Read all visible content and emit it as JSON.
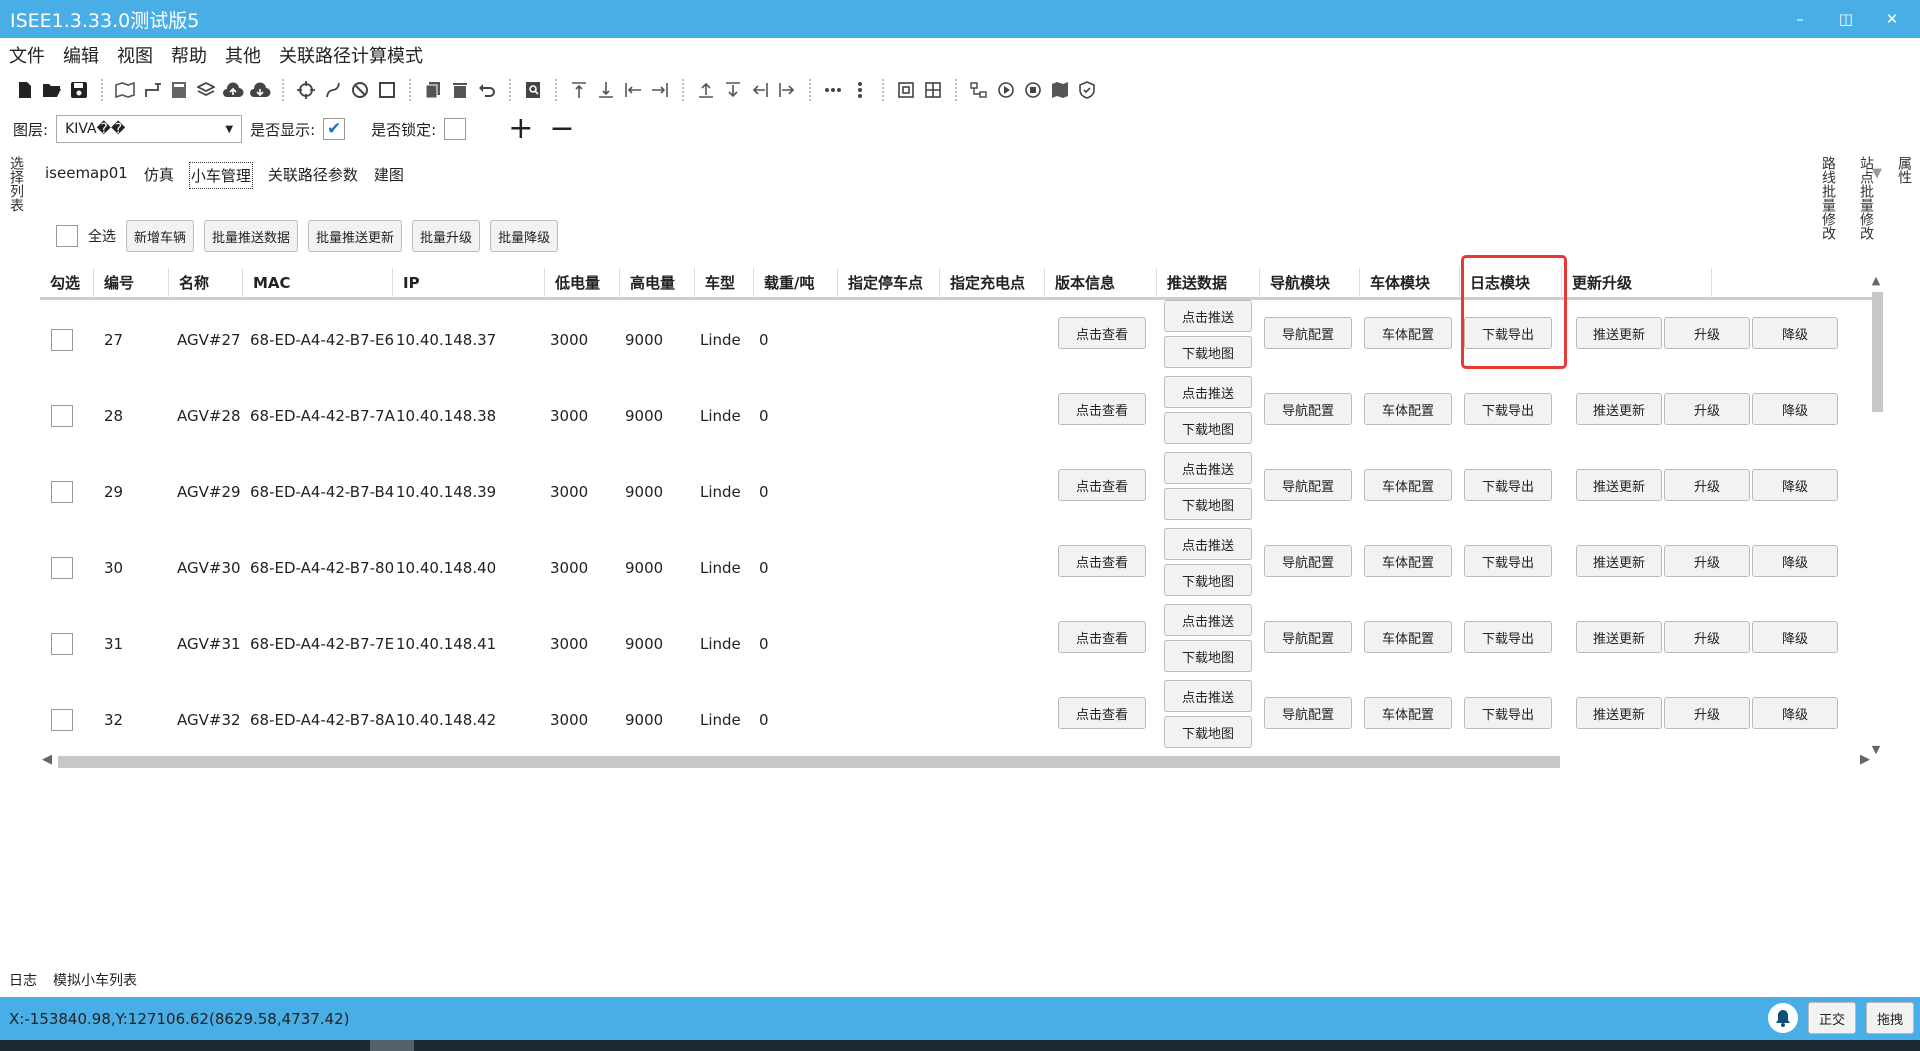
{
  "window": {
    "title": "ISEE1.3.33.0测试版5",
    "min": "–",
    "restore": "◫",
    "close": "✕"
  },
  "menu": [
    "文件",
    "编辑",
    "视图",
    "帮助",
    "其他",
    "关联路径计算模式"
  ],
  "layer": {
    "label": "图层:",
    "value": "KIVA��",
    "show_label": "是否显示:",
    "show_checked": "✔",
    "lock_label": "是否锁定:",
    "plus": "+",
    "minus": "−"
  },
  "left_panel": "选择列表",
  "right_panel": [
    "属性",
    "站点批量修改",
    "路线批量修改"
  ],
  "tabs": [
    "iseemap01",
    "仿真",
    "小车管理",
    "关联路径参数",
    "建图"
  ],
  "actions": {
    "select_all": "全选",
    "buttons": [
      "新增车辆",
      "批量推送数据",
      "批量推送更新",
      "批量升级",
      "批量降级"
    ]
  },
  "columns": [
    "勾选",
    "编号",
    "名称",
    "MAC",
    "IP",
    "低电量",
    "高电量",
    "车型",
    "载重/吨",
    "指定停车点",
    "指定充电点",
    "版本信息",
    "推送数据",
    "导航模块",
    "车体模块",
    "日志模块",
    "更新升级"
  ],
  "row_buttons": {
    "version": "点击查看",
    "push": "点击推送",
    "download_map": "下载地图",
    "nav": "导航配置",
    "body": "车体配置",
    "log": "下载导出",
    "push_update": "推送更新",
    "upgrade": "升级",
    "downgrade": "降级"
  },
  "rows": [
    {
      "id": "27",
      "name": "AGV#27",
      "mac": "68-ED-A4-42-B7-E6",
      "ip": "10.40.148.37",
      "low": "3000",
      "high": "9000",
      "model": "Linde",
      "load": "0"
    },
    {
      "id": "28",
      "name": "AGV#28",
      "mac": "68-ED-A4-42-B7-7A",
      "ip": "10.40.148.38",
      "low": "3000",
      "high": "9000",
      "model": "Linde",
      "load": "0"
    },
    {
      "id": "29",
      "name": "AGV#29",
      "mac": "68-ED-A4-42-B7-B4",
      "ip": "10.40.148.39",
      "low": "3000",
      "high": "9000",
      "model": "Linde",
      "load": "0"
    },
    {
      "id": "30",
      "name": "AGV#30",
      "mac": "68-ED-A4-42-B7-80",
      "ip": "10.40.148.40",
      "low": "3000",
      "high": "9000",
      "model": "Linde",
      "load": "0"
    },
    {
      "id": "31",
      "name": "AGV#31",
      "mac": "68-ED-A4-42-B7-7E",
      "ip": "10.40.148.41",
      "low": "3000",
      "high": "9000",
      "model": "Linde",
      "load": "0"
    },
    {
      "id": "32",
      "name": "AGV#32",
      "mac": "68-ED-A4-42-B7-8A",
      "ip": "10.40.148.42",
      "low": "3000",
      "high": "9000",
      "model": "Linde",
      "load": "0"
    }
  ],
  "bottom_tabs": [
    "日志",
    "模拟小车列表"
  ],
  "status": {
    "coords": "X:-153840.98,Y:127106.62(8629.58,4737.42)",
    "ortho": "正交",
    "drag": "拖拽"
  },
  "colors": {
    "titlebar": "#4aaee6",
    "highlight_box": "#e53935"
  }
}
